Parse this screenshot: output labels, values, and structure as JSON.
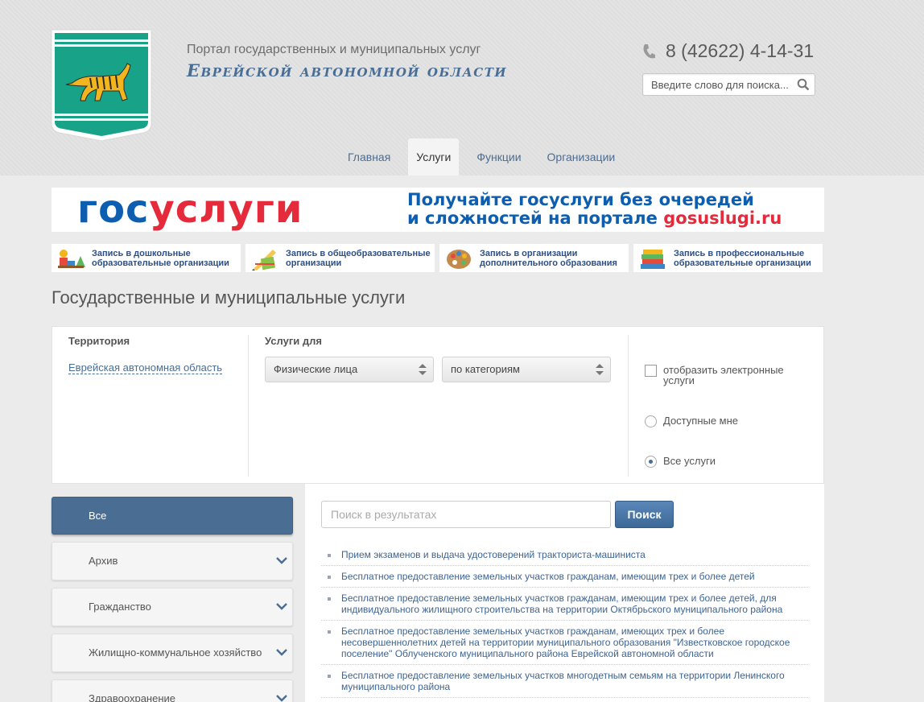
{
  "header": {
    "portal_subtitle": "Портал государственных и муниципальных услуг",
    "portal_title": "Еврейской автономной области",
    "phone": "8 (42622) 4-14-31",
    "search_placeholder": "Введите слово для поиска..."
  },
  "nav": [
    {
      "label": "Главная",
      "active": false
    },
    {
      "label": "Услуги",
      "active": true
    },
    {
      "label": "Функции",
      "active": false
    },
    {
      "label": "Организации",
      "active": false
    }
  ],
  "banner": {
    "logo_part1": "гос",
    "logo_part2": "услуги",
    "line1": "Получайте госуслуги без очередей",
    "line2_prefix": "и сложностей на портале ",
    "line2_link": "gosuslugi.ru"
  },
  "quick_links": [
    {
      "label": "Запись в дошкольные образовательные организации",
      "icon": "toys-icon"
    },
    {
      "label": "Запись в общеобразовательные организации",
      "icon": "school-supplies-icon"
    },
    {
      "label": "Запись в организации дополнительного образования",
      "icon": "palette-icon"
    },
    {
      "label": "Запись в профессиональные образовательные организации",
      "icon": "books-icon"
    }
  ],
  "page_title": "Государственные и муниципальные услуги",
  "filter": {
    "territory_label": "Территория",
    "territory_value": "Еврейская автономная область",
    "services_for_label": "Услуги для",
    "recipient_select": "Физические лица",
    "grouping_select": "по категориям",
    "electronic_checkbox": "отобразить электронные услуги",
    "electronic_checked": false,
    "radio_available": "Доступные мне",
    "radio_all": "Все услуги",
    "radio_selected": "all"
  },
  "categories": [
    {
      "label": "Все",
      "active": true
    },
    {
      "label": "Архив",
      "active": false
    },
    {
      "label": "Гражданство",
      "active": false
    },
    {
      "label": "Жилищно-коммунальное хозяйство",
      "active": false
    },
    {
      "label": "Здравоохранение",
      "active": false
    }
  ],
  "results": {
    "search_placeholder": "Поиск в результатах",
    "search_button": "Поиск",
    "items": [
      "Прием экзаменов и выдача удостоверений тракториста-машиниста",
      "Бесплатное предоставление земельных участков гражданам, имеющим трех и более детей",
      "Бесплатное предоставление земельных участков гражданам, имеющим трех и более детей, для индивидуального жилищного строительства на территории Октябрьского муниципального района",
      "Бесплатное предоставление земельных участков гражданам, имеющих трех и более несовершеннолетних детей на территории муниципального образования \"Известковское городское поселение\" Облученского муниципального района Еврейской автономной области",
      "Бесплатное предоставление земельных участков многодетным семьям на территории Ленинского муниципального района"
    ]
  },
  "colors": {
    "accent": "#4a6d94",
    "gos_blue": "#0d5eb0",
    "gos_red": "#e52b3b",
    "emblem_green": "#18a388"
  }
}
